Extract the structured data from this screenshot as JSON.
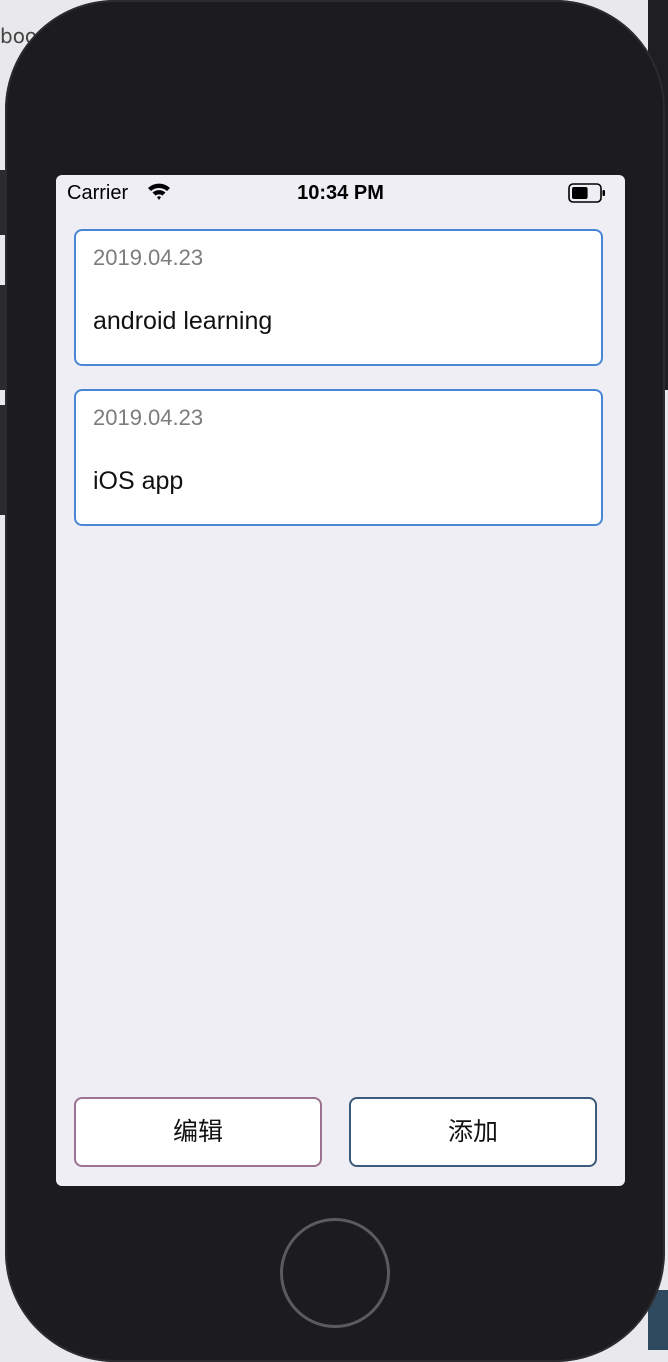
{
  "background": {
    "fragment_top": "boo"
  },
  "status_bar": {
    "carrier": "Carrier",
    "time": "10:34 PM",
    "wifi_icon": "wifi-icon",
    "battery_icon": "battery-icon",
    "battery_level": 0.6
  },
  "notes": [
    {
      "date": "2019.04.23",
      "title": "android learning"
    },
    {
      "date": "2019.04.23",
      "title": "iOS app"
    }
  ],
  "buttons": {
    "edit_label": "编辑",
    "add_label": "添加"
  },
  "colors": {
    "screen_bg": "#efeef5",
    "card_border": "#4a86d6",
    "edit_border": "#9b7292",
    "add_border": "#3e5a79"
  }
}
